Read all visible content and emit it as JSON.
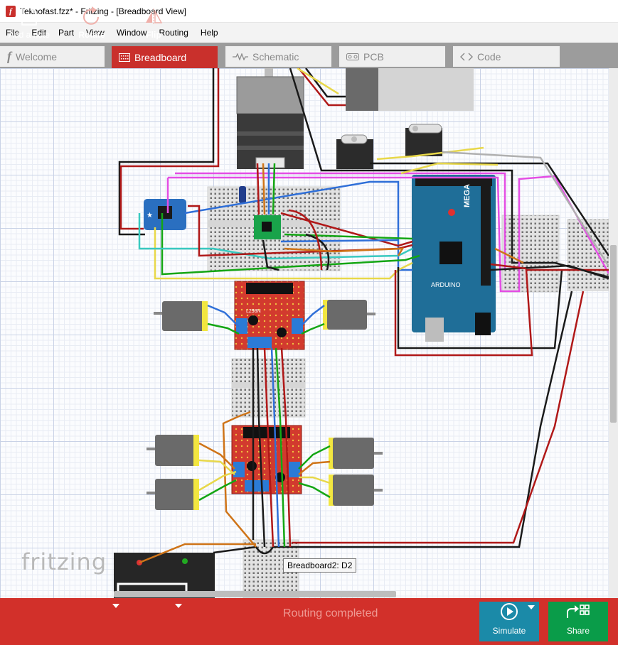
{
  "window": {
    "title": "Teknofast.fzz* - Fritzing - [Breadboard View]",
    "icon": "fritzing-f-icon"
  },
  "menu": [
    "File",
    "Edit",
    "Part",
    "View",
    "Window",
    "Routing",
    "Help"
  ],
  "tabs": [
    {
      "label": "Welcome",
      "icon": "fritzing-f-icon",
      "active": false
    },
    {
      "label": "Breadboard",
      "icon": "breadboard-icon",
      "active": true
    },
    {
      "label": "Schematic",
      "icon": "resistor-zigzag-icon",
      "active": false
    },
    {
      "label": "PCB",
      "icon": "pcb-icon",
      "active": false
    },
    {
      "label": "Code",
      "icon": "code-brackets-icon",
      "active": false
    }
  ],
  "canvas": {
    "logo_text": "fritzing",
    "hover_tooltip": "Breadboard2: D2",
    "parts": {
      "driver_label": "L298N",
      "board_label": "MEGA",
      "arduino_label": "ARDUINO"
    }
  },
  "toolbar": {
    "add_note": "Add a note",
    "rotate": "Rotate",
    "flip": "Flip",
    "status": "Routing completed",
    "simulate": "Simulate",
    "share": "Share"
  },
  "colors": {
    "accent_red": "#d2302a",
    "tab_active": "#c9302c",
    "simulate_bg": "#1b8aa8",
    "share_bg": "#0a9c49"
  }
}
